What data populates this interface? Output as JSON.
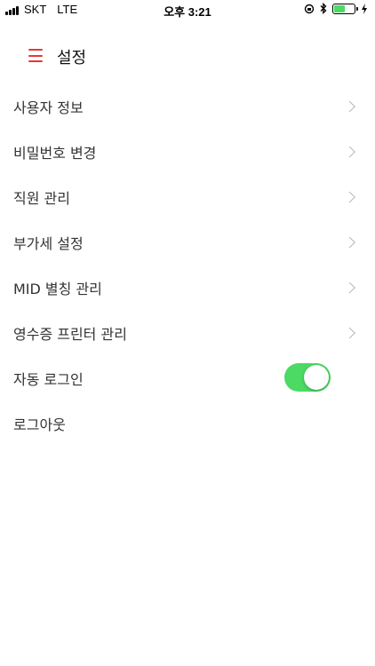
{
  "status_bar": {
    "carrier": "SKT",
    "network": "LTE",
    "time": "오후 3:21",
    "battery_level": 0.55,
    "icons": [
      "signal-icon",
      "lock-rotation-icon",
      "bluetooth-icon",
      "battery-icon",
      "charging-icon"
    ]
  },
  "header": {
    "title": "설정",
    "menu_icon": "hamburger-menu-icon"
  },
  "settings": {
    "items": [
      {
        "label": "사용자 정보",
        "type": "link"
      },
      {
        "label": "비밀번호 변경",
        "type": "link"
      },
      {
        "label": "직원 관리",
        "type": "link"
      },
      {
        "label": "부가세 설정",
        "type": "link"
      },
      {
        "label": "MID 별칭 관리",
        "type": "link"
      },
      {
        "label": "영수증 프린터 관리",
        "type": "link"
      },
      {
        "label": "자동 로그인",
        "type": "toggle",
        "value": true
      },
      {
        "label": "로그아웃",
        "type": "action"
      }
    ]
  },
  "colors": {
    "accent_red": "#e53935",
    "toggle_on": "#4cd964",
    "chevron": "#b8b8b8",
    "text": "#333333"
  }
}
